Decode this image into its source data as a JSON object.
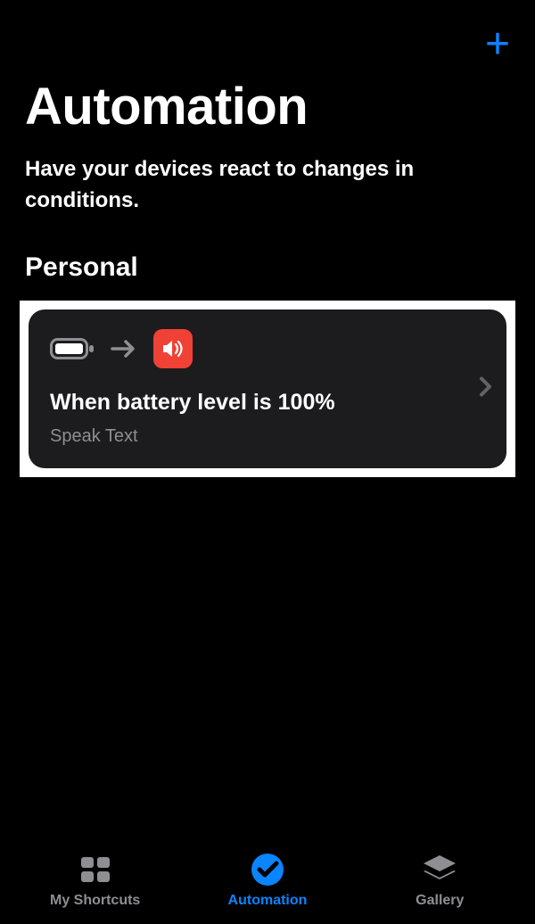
{
  "header": {
    "title": "Automation",
    "subtitle": "Have your devices react to changes in conditions."
  },
  "section": {
    "title": "Personal"
  },
  "automations": [
    {
      "title": "When battery level is 100%",
      "action": "Speak Text"
    }
  ],
  "tabs": {
    "shortcuts": "My Shortcuts",
    "automation": "Automation",
    "gallery": "Gallery"
  }
}
